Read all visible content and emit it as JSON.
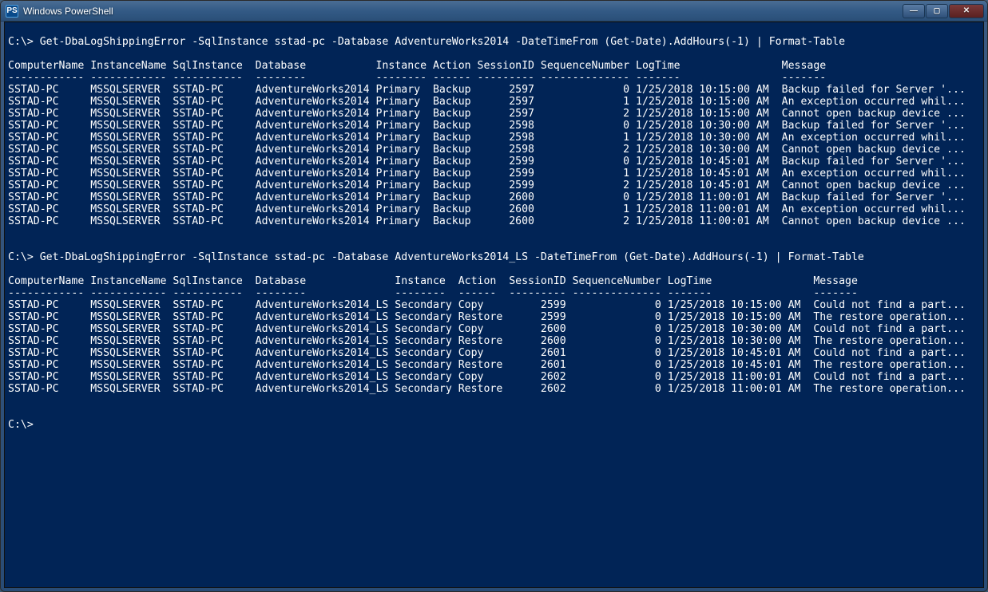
{
  "window": {
    "title": "Windows PowerShell",
    "icon_label": "PS"
  },
  "prompt": "C:\\>",
  "commands": [
    "Get-DbaLogShippingError -SqlInstance sstad-pc -Database AdventureWorks2014 -DateTimeFrom (Get-Date).AddHours(-1) | Format-Table",
    "Get-DbaLogShippingError -SqlInstance sstad-pc -Database AdventureWorks2014_LS -DateTimeFrom (Get-Date).AddHours(-1) | Format-Table"
  ],
  "table1": {
    "columns": [
      "ComputerName",
      "InstanceName",
      "SqlInstance",
      "Database",
      "Instance",
      "Action",
      "SessionID",
      "SequenceNumber",
      "LogTime",
      "Message"
    ],
    "widths": [
      13,
      13,
      13,
      19,
      9,
      7,
      10,
      15,
      23,
      0
    ],
    "rows": [
      [
        "SSTAD-PC",
        "MSSQLSERVER",
        "SSTAD-PC",
        "AdventureWorks2014",
        "Primary",
        "Backup",
        "2597",
        "0",
        "1/25/2018 10:15:00 AM",
        "Backup failed for Server '..."
      ],
      [
        "SSTAD-PC",
        "MSSQLSERVER",
        "SSTAD-PC",
        "AdventureWorks2014",
        "Primary",
        "Backup",
        "2597",
        "1",
        "1/25/2018 10:15:00 AM",
        "An exception occurred whil..."
      ],
      [
        "SSTAD-PC",
        "MSSQLSERVER",
        "SSTAD-PC",
        "AdventureWorks2014",
        "Primary",
        "Backup",
        "2597",
        "2",
        "1/25/2018 10:15:00 AM",
        "Cannot open backup device ..."
      ],
      [
        "SSTAD-PC",
        "MSSQLSERVER",
        "SSTAD-PC",
        "AdventureWorks2014",
        "Primary",
        "Backup",
        "2598",
        "0",
        "1/25/2018 10:30:00 AM",
        "Backup failed for Server '..."
      ],
      [
        "SSTAD-PC",
        "MSSQLSERVER",
        "SSTAD-PC",
        "AdventureWorks2014",
        "Primary",
        "Backup",
        "2598",
        "1",
        "1/25/2018 10:30:00 AM",
        "An exception occurred whil..."
      ],
      [
        "SSTAD-PC",
        "MSSQLSERVER",
        "SSTAD-PC",
        "AdventureWorks2014",
        "Primary",
        "Backup",
        "2598",
        "2",
        "1/25/2018 10:30:00 AM",
        "Cannot open backup device ..."
      ],
      [
        "SSTAD-PC",
        "MSSQLSERVER",
        "SSTAD-PC",
        "AdventureWorks2014",
        "Primary",
        "Backup",
        "2599",
        "0",
        "1/25/2018 10:45:01 AM",
        "Backup failed for Server '..."
      ],
      [
        "SSTAD-PC",
        "MSSQLSERVER",
        "SSTAD-PC",
        "AdventureWorks2014",
        "Primary",
        "Backup",
        "2599",
        "1",
        "1/25/2018 10:45:01 AM",
        "An exception occurred whil..."
      ],
      [
        "SSTAD-PC",
        "MSSQLSERVER",
        "SSTAD-PC",
        "AdventureWorks2014",
        "Primary",
        "Backup",
        "2599",
        "2",
        "1/25/2018 10:45:01 AM",
        "Cannot open backup device ..."
      ],
      [
        "SSTAD-PC",
        "MSSQLSERVER",
        "SSTAD-PC",
        "AdventureWorks2014",
        "Primary",
        "Backup",
        "2600",
        "0",
        "1/25/2018 11:00:01 AM",
        "Backup failed for Server '..."
      ],
      [
        "SSTAD-PC",
        "MSSQLSERVER",
        "SSTAD-PC",
        "AdventureWorks2014",
        "Primary",
        "Backup",
        "2600",
        "1",
        "1/25/2018 11:00:01 AM",
        "An exception occurred whil..."
      ],
      [
        "SSTAD-PC",
        "MSSQLSERVER",
        "SSTAD-PC",
        "AdventureWorks2014",
        "Primary",
        "Backup",
        "2600",
        "2",
        "1/25/2018 11:00:01 AM",
        "Cannot open backup device ..."
      ]
    ],
    "numeric_cols": [
      6,
      7
    ]
  },
  "table2": {
    "columns": [
      "ComputerName",
      "InstanceName",
      "SqlInstance",
      "Database",
      "Instance",
      "Action",
      "SessionID",
      "SequenceNumber",
      "LogTime",
      "Message"
    ],
    "widths": [
      13,
      13,
      13,
      22,
      10,
      8,
      10,
      15,
      23,
      0
    ],
    "rows": [
      [
        "SSTAD-PC",
        "MSSQLSERVER",
        "SSTAD-PC",
        "AdventureWorks2014_LS",
        "Secondary",
        "Copy",
        "2599",
        "0",
        "1/25/2018 10:15:00 AM",
        "Could not find a part..."
      ],
      [
        "SSTAD-PC",
        "MSSQLSERVER",
        "SSTAD-PC",
        "AdventureWorks2014_LS",
        "Secondary",
        "Restore",
        "2599",
        "0",
        "1/25/2018 10:15:00 AM",
        "The restore operation..."
      ],
      [
        "SSTAD-PC",
        "MSSQLSERVER",
        "SSTAD-PC",
        "AdventureWorks2014_LS",
        "Secondary",
        "Copy",
        "2600",
        "0",
        "1/25/2018 10:30:00 AM",
        "Could not find a part..."
      ],
      [
        "SSTAD-PC",
        "MSSQLSERVER",
        "SSTAD-PC",
        "AdventureWorks2014_LS",
        "Secondary",
        "Restore",
        "2600",
        "0",
        "1/25/2018 10:30:00 AM",
        "The restore operation..."
      ],
      [
        "SSTAD-PC",
        "MSSQLSERVER",
        "SSTAD-PC",
        "AdventureWorks2014_LS",
        "Secondary",
        "Copy",
        "2601",
        "0",
        "1/25/2018 10:45:01 AM",
        "Could not find a part..."
      ],
      [
        "SSTAD-PC",
        "MSSQLSERVER",
        "SSTAD-PC",
        "AdventureWorks2014_LS",
        "Secondary",
        "Restore",
        "2601",
        "0",
        "1/25/2018 10:45:01 AM",
        "The restore operation..."
      ],
      [
        "SSTAD-PC",
        "MSSQLSERVER",
        "SSTAD-PC",
        "AdventureWorks2014_LS",
        "Secondary",
        "Copy",
        "2602",
        "0",
        "1/25/2018 11:00:01 AM",
        "Could not find a part..."
      ],
      [
        "SSTAD-PC",
        "MSSQLSERVER",
        "SSTAD-PC",
        "AdventureWorks2014_LS",
        "Secondary",
        "Restore",
        "2602",
        "0",
        "1/25/2018 11:00:01 AM",
        "The restore operation..."
      ]
    ],
    "numeric_cols": [
      6,
      7
    ]
  }
}
